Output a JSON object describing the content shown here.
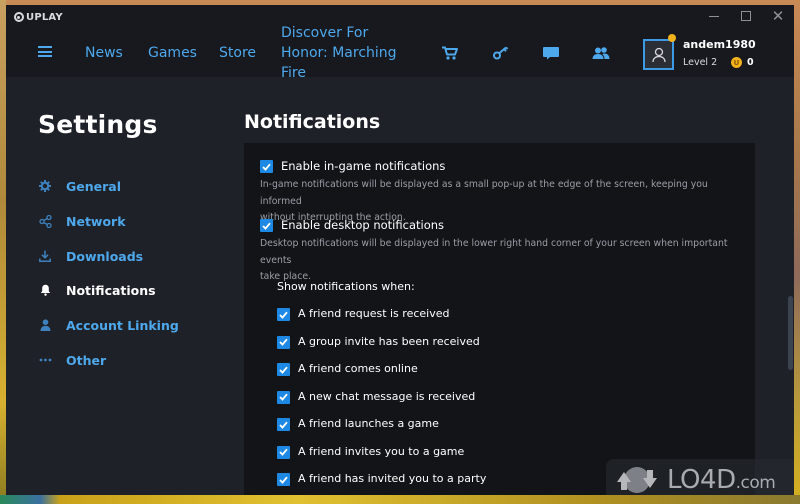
{
  "window": {
    "brand": "UPLAY",
    "controls": {
      "minimize": "minimize",
      "maximize": "maximize",
      "close": "close"
    }
  },
  "header": {
    "nav": [
      {
        "label": "News"
      },
      {
        "label": "Games"
      },
      {
        "label": "Store"
      },
      {
        "label": "Discover For Honor: Marching Fire"
      }
    ],
    "icons": [
      "cart-icon",
      "key-icon",
      "chat-icon",
      "friends-icon"
    ],
    "user": {
      "name": "andem1980",
      "level": "Level 2",
      "units": "0",
      "coin_glyph": "U",
      "notification_dot_color": "#f2b21b"
    }
  },
  "sidebar": {
    "title": "Settings",
    "items": [
      {
        "label": "General",
        "icon": "gear-icon",
        "active": false
      },
      {
        "label": "Network",
        "icon": "network-icon",
        "active": false
      },
      {
        "label": "Downloads",
        "icon": "download-icon",
        "active": false
      },
      {
        "label": "Notifications",
        "icon": "bell-icon",
        "active": true
      },
      {
        "label": "Account Linking",
        "icon": "user-icon",
        "active": false
      },
      {
        "label": "Other",
        "icon": "more-icon",
        "active": false
      }
    ]
  },
  "content": {
    "title": "Notifications",
    "options": [
      {
        "label": "Enable in-game notifications",
        "checked": true,
        "description_line1": "In-game notifications will be displayed as a small pop-up at the edge of the screen, keeping you informed",
        "description_line2": "without interrupting the action."
      },
      {
        "label": "Enable desktop notifications",
        "checked": true,
        "description_line1": "Desktop notifications will be displayed in the lower right hand corner of your screen when important events",
        "description_line2": "take place."
      }
    ],
    "show_when_title": "Show notifications when:",
    "show_when": [
      {
        "label": "A friend request is received",
        "checked": true
      },
      {
        "label": "A group invite has been received",
        "checked": true
      },
      {
        "label": "A friend comes online",
        "checked": true
      },
      {
        "label": "A new chat message is received",
        "checked": true
      },
      {
        "label": "A friend launches a game",
        "checked": true
      },
      {
        "label": "A friend invites you to a game",
        "checked": true
      },
      {
        "label": "A friend has invited you to a party",
        "checked": true
      }
    ]
  },
  "watermark": {
    "text": "LO4D",
    "suffix": ".com"
  },
  "colors": {
    "accent": "#4ea8ec",
    "checkbox": "#1e88e5",
    "header_bg": "#17191e",
    "body_bg": "#1e2128",
    "panel_bg": "#121418"
  }
}
